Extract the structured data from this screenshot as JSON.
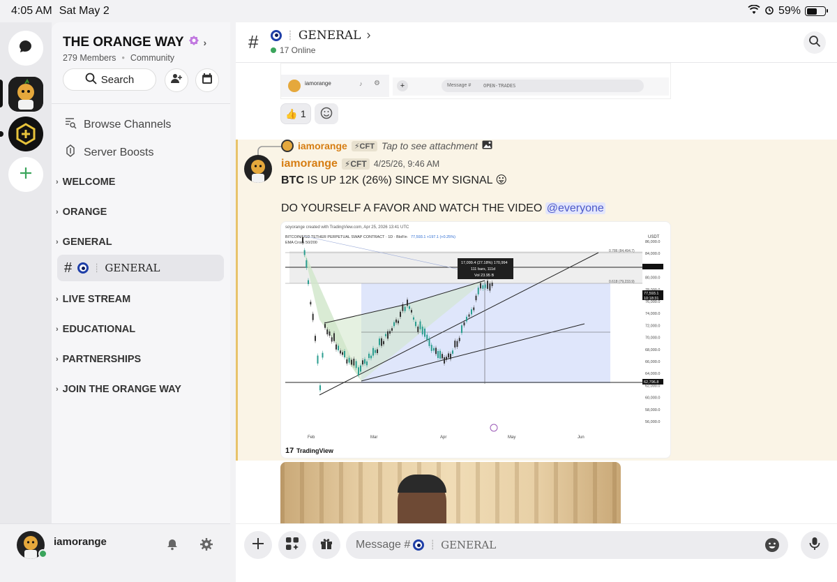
{
  "status": {
    "time": "4:05 AM",
    "date": "Sat May 2",
    "battery": "59%",
    "battery_level": 0.59
  },
  "server": {
    "name": "THE ORANGE WAY",
    "members": "279 Members",
    "type": "Community",
    "search_label": "Search"
  },
  "sidebar": {
    "browse_channels": "Browse Channels",
    "server_boosts": "Server Boosts",
    "categories": [
      "WELCOME",
      "ORANGE",
      "GENERAL",
      "LIVE STREAM",
      "EDUCATIONAL",
      "PARTNERSHIPS",
      "JOIN THE ORANGE WAY"
    ],
    "active_channel": "GENERAL"
  },
  "user": {
    "name": "iamorange"
  },
  "header": {
    "channel": "GENERAL",
    "online": "17 Online"
  },
  "prev_message": {
    "user": "iamorange",
    "input_placeholder": "Message #",
    "input_channel": "OPEN-TRADES",
    "reaction_count": "1"
  },
  "message": {
    "reply_user": "iamorange",
    "reply_tag": "⚡CFT",
    "reply_text": "Tap to see attachment",
    "user": "iamorange",
    "tag": "⚡CFT",
    "timestamp": "4/25/26, 9:46 AM",
    "line1_bold": "BTC",
    "line1_rest": "IS UP 12K (26%) SINCE MY SIGNAL 😛",
    "line2": "DO YOURSELF A FAVOR AND WATCH THE VIDEO",
    "mention": "@everyone"
  },
  "attachment": {
    "credit": "soyorange created with TradingView.com, Apr 25, 2026 13:41 UTC",
    "symbol": "BITCOIN/USD TETHER PERPETUAL SWAP CONTRACT · 1D · BloFin",
    "quote": "77,593.1 +197.1 (+0.25%)",
    "indicator": "EMA Cross 50/200",
    "axis_unit": "USDT",
    "price_labels": [
      "86,000.0",
      "84,000.0",
      "82,000.0",
      "80,000.0",
      "78,000.0",
      "76,000.0",
      "74,000.0",
      "72,000.0",
      "70,000.0",
      "68,000.0",
      "66,000.0",
      "64,000.0",
      "62,000.0",
      "60,000.0",
      "58,000.0",
      "56,000.0"
    ],
    "fib1": "0.786 (84,494.7)",
    "fib2": "0.618 (79,233.9)",
    "tooltip1": "17,099.4 (27.18%) 170,994",
    "tooltip2": "111 bars, 111d",
    "tooltip3": "Vol 23.95 B",
    "last_price": "77,593.1",
    "countdown": "10:18:31",
    "low_price": "62,796.8",
    "months": [
      "Feb",
      "Mar",
      "Apr",
      "May",
      "Jun"
    ],
    "brand": "TradingView"
  },
  "composer": {
    "placeholder": "Message #",
    "channel": "GENERAL"
  },
  "colors": {
    "accent_orange": "#d67d12",
    "highlight_bg": "#faf4e6",
    "mention": "#4b58c9",
    "online": "#3ba55c"
  }
}
